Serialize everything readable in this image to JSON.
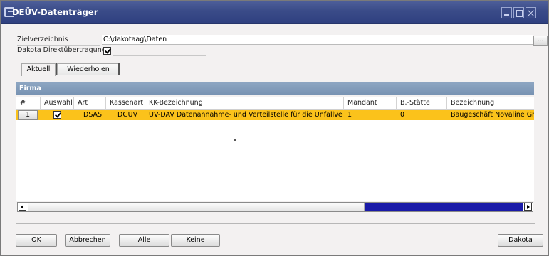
{
  "window": {
    "title": "DEÜV-Datenträger"
  },
  "form": {
    "zielverzeichnis_label": "Zielverzeichnis",
    "zielverzeichnis_value": "C:\\dakotaag\\Daten",
    "browse_label": "...",
    "direkt_label": "Dakota Direktübertragung",
    "direkt_checked": true
  },
  "tabs": [
    {
      "label": "Aktuell",
      "active": true
    },
    {
      "label": "Wiederholen",
      "active": false
    }
  ],
  "grid": {
    "title": "Firma",
    "columns": [
      "#",
      "Auswahl",
      "Art",
      "Kassenart",
      "KK-Bezeichnung",
      "Mandant",
      "B.-Stätte",
      "Bezeichnung"
    ],
    "rows": [
      {
        "num": "1",
        "auswahl": true,
        "art": "DSAS",
        "kassenart": "DGUV",
        "kk_bezeichnung": "UV-DAV Datenannahme- und Verteilstelle für die Unfallversiche",
        "mandant": "1",
        "b_staette": "0",
        "bezeichnung": "Baugeschäft Novaline GmbH"
      }
    ],
    "row_highlight_color": "#fbc21b",
    "header_color": "#7f99b8"
  },
  "buttons": {
    "ok": "OK",
    "abbrechen": "Abbrechen",
    "alle": "Alle",
    "keine": "Keine",
    "dakota": "Dakota"
  },
  "colors": {
    "titlebar": "#3a4b88",
    "scroll_track": "#1a1aa8"
  }
}
